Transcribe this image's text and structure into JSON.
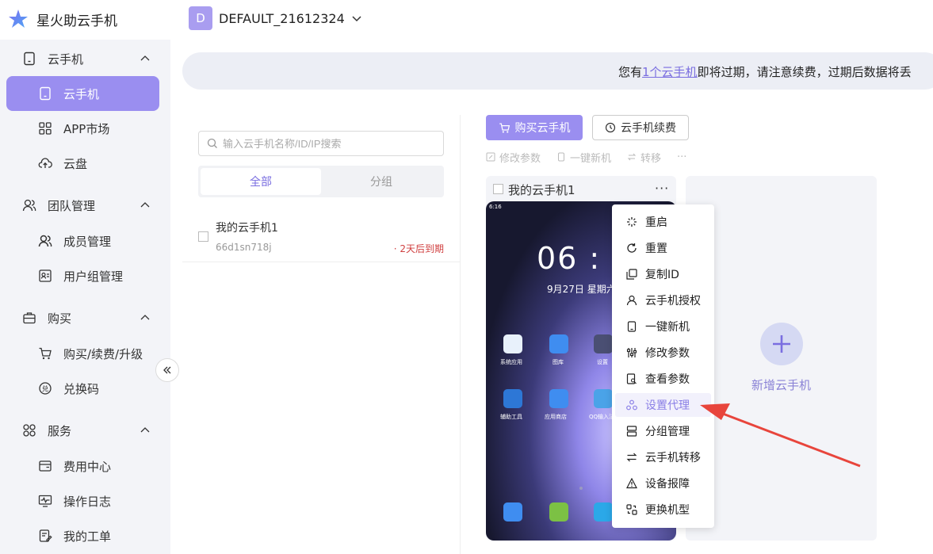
{
  "app": {
    "title": "星火助云手机"
  },
  "account": {
    "initial": "D",
    "name": "DEFAULT_21612324"
  },
  "sidebar": {
    "groups": [
      {
        "label": "云手机",
        "items": [
          "云手机",
          "APP市场",
          "云盘"
        ]
      },
      {
        "label": "团队管理",
        "items": [
          "成员管理",
          "用户组管理"
        ]
      },
      {
        "label": "购买",
        "items": [
          "购买/续费/升级",
          "兑换码"
        ]
      },
      {
        "label": "服务",
        "items": [
          "费用中心",
          "操作日志",
          "我的工单"
        ]
      }
    ],
    "active_item": "云手机"
  },
  "notice": {
    "prefix": "您有",
    "link": "1个云手机",
    "suffix": "即将过期，请注意续费，过期后数据将丢"
  },
  "search": {
    "placeholder": "输入云手机名称/ID/IP搜索",
    "value": ""
  },
  "tabs": [
    "全部",
    "分组"
  ],
  "phones": [
    {
      "name": "我的云手机1",
      "id": "66d1sn718j",
      "expire": "· 2天后到期"
    }
  ],
  "toolbar": {
    "buy_label": "购买云手机",
    "renew_label": "云手机续费",
    "modify_params": "修改参数",
    "one_click_new": "一键新机",
    "transfer": "转移",
    "more": "···"
  },
  "card": {
    "name": "我的云手机1",
    "more": "···",
    "screen": {
      "status_time": "6:16",
      "clock": "06 : 16",
      "date": "9月27日 星期六",
      "apps_row1": [
        "系统应用",
        "图库",
        "设置"
      ],
      "apps_row2": [
        "辅助工具",
        "应用商店",
        "QQ输入法"
      ]
    }
  },
  "add_card": {
    "label": "新增云手机"
  },
  "context_menu": {
    "items": [
      "重启",
      "重置",
      "复制ID",
      "云手机授权",
      "一键新机",
      "修改参数",
      "查看参数",
      "设置代理",
      "分组管理",
      "云手机转移",
      "设备报障",
      "更换机型"
    ],
    "highlighted": "设置代理"
  },
  "colors": {
    "accent": "#9a8ef0",
    "accent_text": "#7a6ee0",
    "sidebar_bg": "#f3f4f8",
    "arrow": "#e8453c"
  }
}
